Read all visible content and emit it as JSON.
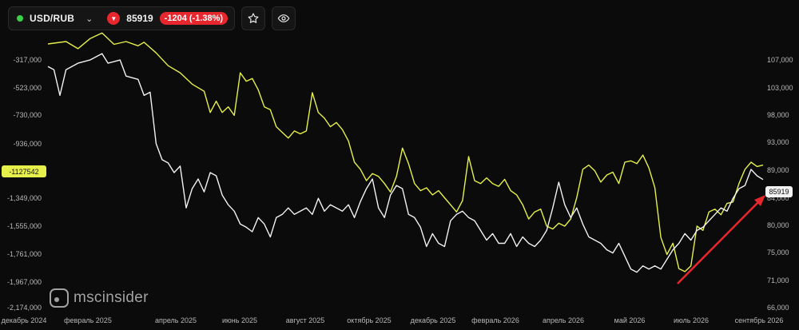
{
  "header": {
    "symbol": "USD/RUB",
    "price": "85919",
    "change": "-1204 (-1.38%)",
    "status_color": "#3ad04a",
    "down_color": "#e8262d"
  },
  "watermark": {
    "text": "mscinsider"
  },
  "chart_data": {
    "type": "line",
    "title": "",
    "x_ticks": [
      "декабрь 2024",
      "февраль 2025",
      "апрель 2025",
      "июнь 2025",
      "август 2025",
      "октябрь 2025",
      "декабрь 2025",
      "февраль 2026",
      "апрель 2026",
      "май 2026",
      "июль 2026",
      "сентябрь 2026"
    ],
    "left_axis": {
      "ticks": [
        "-317,000",
        "-523,000",
        "-730,000",
        "-936,000",
        "-1,349,000",
        "-1,555,000",
        "-1,761,000",
        "-1,967,000",
        "-2,174,000"
      ],
      "current_label": "-1127542",
      "current_label_color": "#e6f04a"
    },
    "right_axis": {
      "ticks": [
        "107,000",
        "103,000",
        "98,000",
        "93,000",
        "89,000",
        "84,000",
        "80,000",
        "75,000",
        "71,000",
        "66,000"
      ],
      "current_label": "85919"
    },
    "series": [
      {
        "color": "#e6f04a",
        "axis": "left",
        "points": [
          [
            0,
            -317000
          ],
          [
            3,
            -300000
          ],
          [
            5,
            -350000
          ],
          [
            7,
            -280000
          ],
          [
            9,
            -240000
          ],
          [
            11,
            -320000
          ],
          [
            13,
            -300000
          ],
          [
            15,
            -330000
          ],
          [
            16,
            -305000
          ],
          [
            18,
            -380000
          ],
          [
            20,
            -470000
          ],
          [
            22,
            -520000
          ],
          [
            24,
            -600000
          ],
          [
            26,
            -650000
          ],
          [
            27,
            -800000
          ],
          [
            28,
            -720000
          ],
          [
            29,
            -800000
          ],
          [
            30,
            -760000
          ],
          [
            31,
            -820000
          ],
          [
            32,
            -520000
          ],
          [
            33,
            -580000
          ],
          [
            34,
            -560000
          ],
          [
            35,
            -640000
          ],
          [
            36,
            -760000
          ],
          [
            37,
            -780000
          ],
          [
            38,
            -900000
          ],
          [
            39,
            -940000
          ],
          [
            40,
            -980000
          ],
          [
            41,
            -930000
          ],
          [
            42,
            -950000
          ],
          [
            43,
            -930000
          ],
          [
            44,
            -660000
          ],
          [
            45,
            -800000
          ],
          [
            46,
            -840000
          ],
          [
            47,
            -900000
          ],
          [
            48,
            -870000
          ],
          [
            49,
            -920000
          ],
          [
            50,
            -1000000
          ],
          [
            51,
            -1150000
          ],
          [
            52,
            -1200000
          ],
          [
            53,
            -1280000
          ],
          [
            54,
            -1230000
          ],
          [
            55,
            -1250000
          ],
          [
            56,
            -1300000
          ],
          [
            57,
            -1360000
          ],
          [
            58,
            -1250000
          ],
          [
            59,
            -1050000
          ],
          [
            60,
            -1160000
          ],
          [
            61,
            -1300000
          ],
          [
            62,
            -1350000
          ],
          [
            63,
            -1330000
          ],
          [
            64,
            -1380000
          ],
          [
            65,
            -1350000
          ],
          [
            66,
            -1400000
          ],
          [
            67,
            -1450000
          ],
          [
            68,
            -1500000
          ],
          [
            69,
            -1420000
          ],
          [
            70,
            -1110000
          ],
          [
            71,
            -1280000
          ],
          [
            72,
            -1300000
          ],
          [
            73,
            -1260000
          ],
          [
            74,
            -1300000
          ],
          [
            75,
            -1320000
          ],
          [
            76,
            -1270000
          ],
          [
            77,
            -1350000
          ],
          [
            78,
            -1380000
          ],
          [
            79,
            -1450000
          ],
          [
            80,
            -1550000
          ],
          [
            81,
            -1500000
          ],
          [
            82,
            -1480000
          ],
          [
            83,
            -1600000
          ],
          [
            84,
            -1620000
          ],
          [
            85,
            -1580000
          ],
          [
            86,
            -1600000
          ],
          [
            87,
            -1550000
          ],
          [
            88,
            -1400000
          ],
          [
            89,
            -1200000
          ],
          [
            90,
            -1170000
          ],
          [
            91,
            -1210000
          ],
          [
            92,
            -1290000
          ],
          [
            93,
            -1240000
          ],
          [
            94,
            -1220000
          ],
          [
            95,
            -1300000
          ],
          [
            96,
            -1150000
          ],
          [
            97,
            -1140000
          ],
          [
            98,
            -1160000
          ],
          [
            99,
            -1100000
          ],
          [
            100,
            -1190000
          ],
          [
            101,
            -1330000
          ],
          [
            102,
            -1680000
          ],
          [
            103,
            -1800000
          ],
          [
            104,
            -1720000
          ],
          [
            105,
            -1900000
          ],
          [
            106,
            -1920000
          ],
          [
            107,
            -1880000
          ],
          [
            108,
            -1600000
          ],
          [
            109,
            -1630000
          ],
          [
            110,
            -1500000
          ],
          [
            111,
            -1480000
          ],
          [
            112,
            -1520000
          ],
          [
            113,
            -1440000
          ],
          [
            114,
            -1430000
          ],
          [
            115,
            -1300000
          ],
          [
            116,
            -1200000
          ],
          [
            117,
            -1150000
          ],
          [
            118,
            -1180000
          ],
          [
            119,
            -1170000
          ]
        ],
        "x_max": 119
      },
      {
        "color": "#f2f2f2",
        "axis": "right",
        "points": [
          [
            0,
            103500
          ],
          [
            1,
            103000
          ],
          [
            2,
            99000
          ],
          [
            3,
            103000
          ],
          [
            5,
            104000
          ],
          [
            7,
            104500
          ],
          [
            9,
            105500
          ],
          [
            10,
            104000
          ],
          [
            12,
            104500
          ],
          [
            13,
            102000
          ],
          [
            15,
            101500
          ],
          [
            16,
            99000
          ],
          [
            17,
            99500
          ],
          [
            18,
            91500
          ],
          [
            19,
            89000
          ],
          [
            20,
            88500
          ],
          [
            21,
            87000
          ],
          [
            22,
            88000
          ],
          [
            23,
            81500
          ],
          [
            24,
            84500
          ],
          [
            25,
            86000
          ],
          [
            26,
            84000
          ],
          [
            27,
            87000
          ],
          [
            28,
            86500
          ],
          [
            29,
            83500
          ],
          [
            30,
            82000
          ],
          [
            31,
            81000
          ],
          [
            32,
            79000
          ],
          [
            33,
            78500
          ],
          [
            34,
            77800
          ],
          [
            35,
            80000
          ],
          [
            36,
            79000
          ],
          [
            37,
            77000
          ],
          [
            38,
            80000
          ],
          [
            39,
            80500
          ],
          [
            40,
            81500
          ],
          [
            41,
            80500
          ],
          [
            42,
            81000
          ],
          [
            43,
            81500
          ],
          [
            44,
            80500
          ],
          [
            45,
            83000
          ],
          [
            46,
            81000
          ],
          [
            47,
            82000
          ],
          [
            48,
            81500
          ],
          [
            49,
            81000
          ],
          [
            50,
            82000
          ],
          [
            51,
            80000
          ],
          [
            52,
            82500
          ],
          [
            53,
            84500
          ],
          [
            54,
            86000
          ],
          [
            55,
            81500
          ],
          [
            56,
            80000
          ],
          [
            57,
            83500
          ],
          [
            58,
            85000
          ],
          [
            59,
            84500
          ],
          [
            60,
            80500
          ],
          [
            61,
            80000
          ],
          [
            62,
            78500
          ],
          [
            63,
            75500
          ],
          [
            64,
            77500
          ],
          [
            65,
            76000
          ],
          [
            66,
            75500
          ],
          [
            67,
            79500
          ],
          [
            68,
            80500
          ],
          [
            69,
            81000
          ],
          [
            70,
            80000
          ],
          [
            71,
            79500
          ],
          [
            72,
            78000
          ],
          [
            73,
            76500
          ],
          [
            74,
            77500
          ],
          [
            75,
            76000
          ],
          [
            76,
            76000
          ],
          [
            77,
            77500
          ],
          [
            78,
            75500
          ],
          [
            79,
            77000
          ],
          [
            80,
            76000
          ],
          [
            81,
            75500
          ],
          [
            82,
            76500
          ],
          [
            83,
            78000
          ],
          [
            84,
            81500
          ],
          [
            85,
            85500
          ],
          [
            86,
            82000
          ],
          [
            87,
            80000
          ],
          [
            88,
            81500
          ],
          [
            89,
            79000
          ],
          [
            90,
            77000
          ],
          [
            91,
            76500
          ],
          [
            92,
            76000
          ],
          [
            93,
            75000
          ],
          [
            94,
            74500
          ],
          [
            95,
            76000
          ],
          [
            96,
            74000
          ],
          [
            97,
            72000
          ],
          [
            98,
            71500
          ],
          [
            99,
            72500
          ],
          [
            100,
            72000
          ],
          [
            101,
            72500
          ],
          [
            102,
            72000
          ],
          [
            103,
            73500
          ],
          [
            104,
            75000
          ],
          [
            105,
            76000
          ],
          [
            106,
            77500
          ],
          [
            107,
            76500
          ],
          [
            108,
            78000
          ],
          [
            109,
            78500
          ],
          [
            110,
            79500
          ],
          [
            111,
            80500
          ],
          [
            112,
            81500
          ],
          [
            113,
            81000
          ],
          [
            114,
            83000
          ],
          [
            115,
            84500
          ],
          [
            116,
            85000
          ],
          [
            117,
            87500
          ],
          [
            118,
            86500
          ],
          [
            119,
            85919
          ]
        ],
        "x_max": 119
      }
    ],
    "left_range": [
      -2174000,
      -317000
    ],
    "right_range": [
      66000,
      107000
    ],
    "grid": false
  }
}
